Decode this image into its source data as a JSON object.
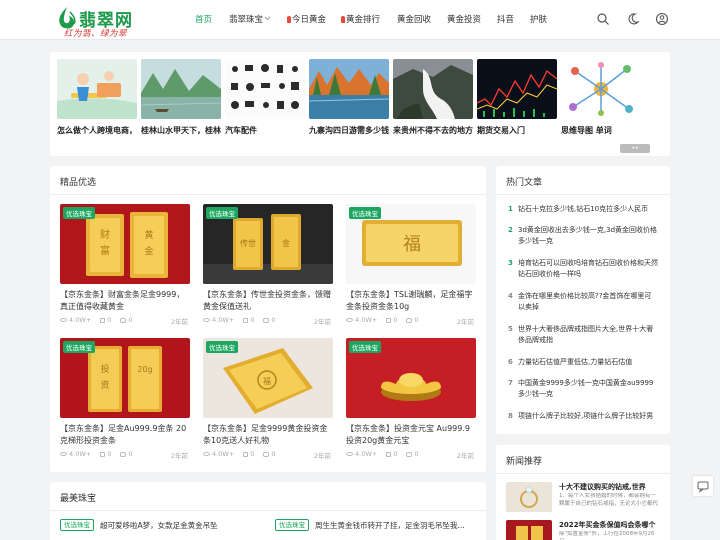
{
  "header": {
    "site_name": "翡翠网",
    "slogan": "红为翡、绿为翠",
    "nav": [
      {
        "label": "首页",
        "active": true,
        "hot": false
      },
      {
        "label": "翡翠珠宝",
        "active": false,
        "hot": false,
        "dropdown": true
      },
      {
        "label": "今日黄金",
        "active": false,
        "hot": true
      },
      {
        "label": "黄金排行",
        "active": false,
        "hot": true
      },
      {
        "label": "黄金回收",
        "active": false,
        "hot": false
      },
      {
        "label": "黄金投资",
        "active": false,
        "hot": false
      },
      {
        "label": "抖音",
        "active": false,
        "hot": false
      },
      {
        "label": "护肤",
        "active": false,
        "hot": false
      }
    ],
    "icons": [
      "search-icon",
      "moon-icon",
      "user-icon"
    ],
    "accent_color": "#1da660"
  },
  "banner": {
    "items": [
      {
        "caption": "怎么做个人跨境电商，"
      },
      {
        "caption": "桂林山水甲天下，桂林"
      },
      {
        "caption": "汽车配件"
      },
      {
        "caption": "九寨沟四日游需多少钱"
      },
      {
        "caption": "来贵州不得不去的地方"
      },
      {
        "caption": "期货交易入门"
      },
      {
        "caption": "思维导图 单词"
      }
    ]
  },
  "featured": {
    "title": "精品优选",
    "items": [
      {
        "tag": "优选珠宝",
        "title": "【京东金条】财富金条足金9999，真正值得收藏黄金",
        "views": "4.0W+",
        "likes": "0",
        "comments": "0",
        "date": "2年前"
      },
      {
        "tag": "优选珠宝",
        "title": "【京东金条】传世金投资金条，馈赠黄金保值送礼",
        "views": "4.0W+",
        "likes": "0",
        "comments": "0",
        "date": "2年前"
      },
      {
        "tag": "优选珠宝",
        "title": "【京东金条】TSL谢瑞麟，足金福字金条投资金条10g",
        "views": "4.0W+",
        "likes": "0",
        "comments": "0",
        "date": "2年前"
      },
      {
        "tag": "优选珠宝",
        "title": "【京东金条】足金Au999.9金条 20克梯形投资金条",
        "views": "4.0W+",
        "likes": "0",
        "comments": "0",
        "date": "2年前"
      },
      {
        "tag": "优选珠宝",
        "title": "【京东金条】足金9999黄金投资金条10克送人好礼物",
        "views": "4.0W+",
        "likes": "0",
        "comments": "0",
        "date": "2年前"
      },
      {
        "tag": "优选珠宝",
        "title": "【京东金条】投资金元宝 Au999.9投资20g黄金元宝",
        "views": "4.0W+",
        "likes": "0",
        "comments": "0",
        "date": "2年前"
      }
    ]
  },
  "hot": {
    "title": "热门文章",
    "items": [
      {
        "rank": "1",
        "text": "钻石十克拉多少钱,钻石10克拉多少人民币"
      },
      {
        "rank": "2",
        "text": "3d黄金回收出去多少钱一克,3d黄金回收价格多少钱一克"
      },
      {
        "rank": "3",
        "text": "培育钻石可以回收吗培育钻石回收价格和天然钻石回收价格一样吗"
      },
      {
        "rank": "4",
        "text": "金饰在哪里卖价格比较高??金首饰在哪里可以卖掉"
      },
      {
        "rank": "5",
        "text": "世界十大奢侈品牌戒指图片大全,世界十大奢侈品牌戒指"
      },
      {
        "rank": "6",
        "text": "力量钻石估值严重低估,力量钻石估值"
      },
      {
        "rank": "7",
        "text": "中国黄金9999多少钱一克中国黄金au9999多少钱一克"
      },
      {
        "rank": "8",
        "text": "项链什么牌子比较好,项链什么牌子比较好男"
      }
    ]
  },
  "news": {
    "title": "新闻推荐",
    "items": [
      {
        "title": "十大不建议购买的钻戒,世界",
        "desc": "1、每个人女孩结婚的时候，都会拥有一颗属于自己的钻石戒指，无论大小它都代"
      },
      {
        "title": "2022年买金条保值吗会条哪个",
        "desc": "除\"如置金条\"外，工行在2008年9月26日"
      }
    ]
  },
  "best": {
    "title": "最美珠宝",
    "items": [
      {
        "tag": "优选珠宝",
        "text": "超可爱哆啦A梦，女款足金黄金吊坠"
      },
      {
        "tag": "优选珠宝",
        "text": "周生生黄金钱币转开了挂，足金羽毛吊坠我..."
      }
    ]
  }
}
